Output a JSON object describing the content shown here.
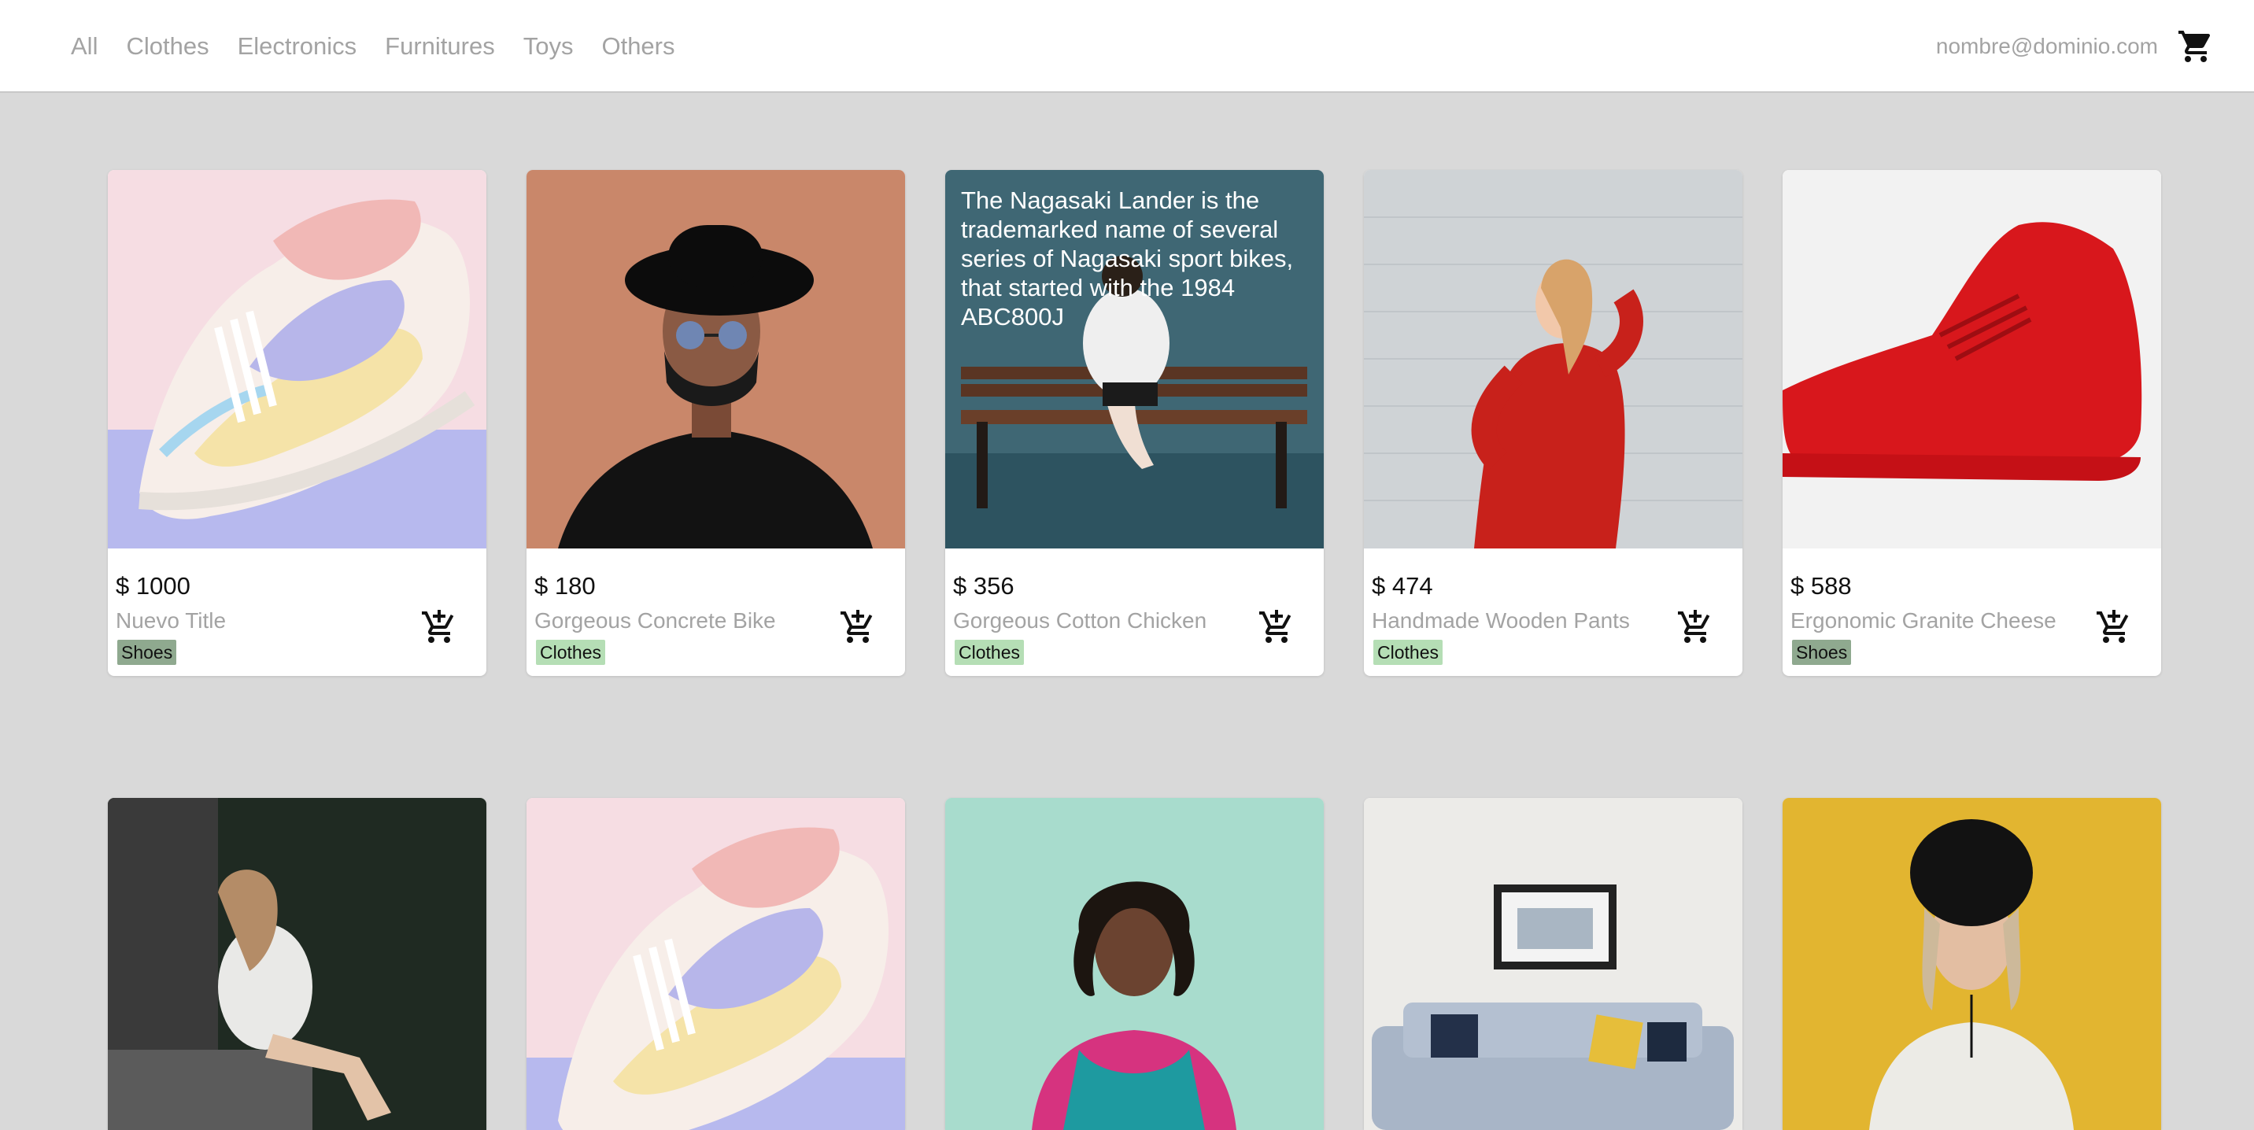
{
  "nav": {
    "links": [
      "All",
      "Clothes",
      "Electronics",
      "Furnitures",
      "Toys",
      "Others"
    ],
    "email": "nombre@dominio.com",
    "cart_icon": "shopping-cart-icon"
  },
  "products": [
    {
      "price": "$ 1000",
      "title": "Nuevo Title",
      "category": "Shoes",
      "category_color": "#8fa98f"
    },
    {
      "price": "$ 180",
      "title": "Gorgeous Concrete Bike",
      "category": "Clothes",
      "category_color": "#b5deb5"
    },
    {
      "price": "$ 356",
      "title": "Gorgeous Cotton Chicken",
      "category": "Clothes",
      "category_color": "#b5deb5",
      "description": "The Nagasaki Lander is the trademarked name of several series of Nagasaki sport bikes, that started with the 1984 ABC800J"
    },
    {
      "price": "$ 474",
      "title": "Handmade Wooden Pants",
      "category": "Clothes",
      "category_color": "#b5deb5"
    },
    {
      "price": "$ 588",
      "title": "Ergonomic Granite Cheese",
      "category": "Shoes",
      "category_color": "#8fa98f"
    }
  ],
  "colors": {
    "background": "#d9d9d9",
    "nav_text": "#a3a3a3",
    "shoes_badge": "#8fa98f",
    "clothes_badge": "#b5deb5"
  }
}
